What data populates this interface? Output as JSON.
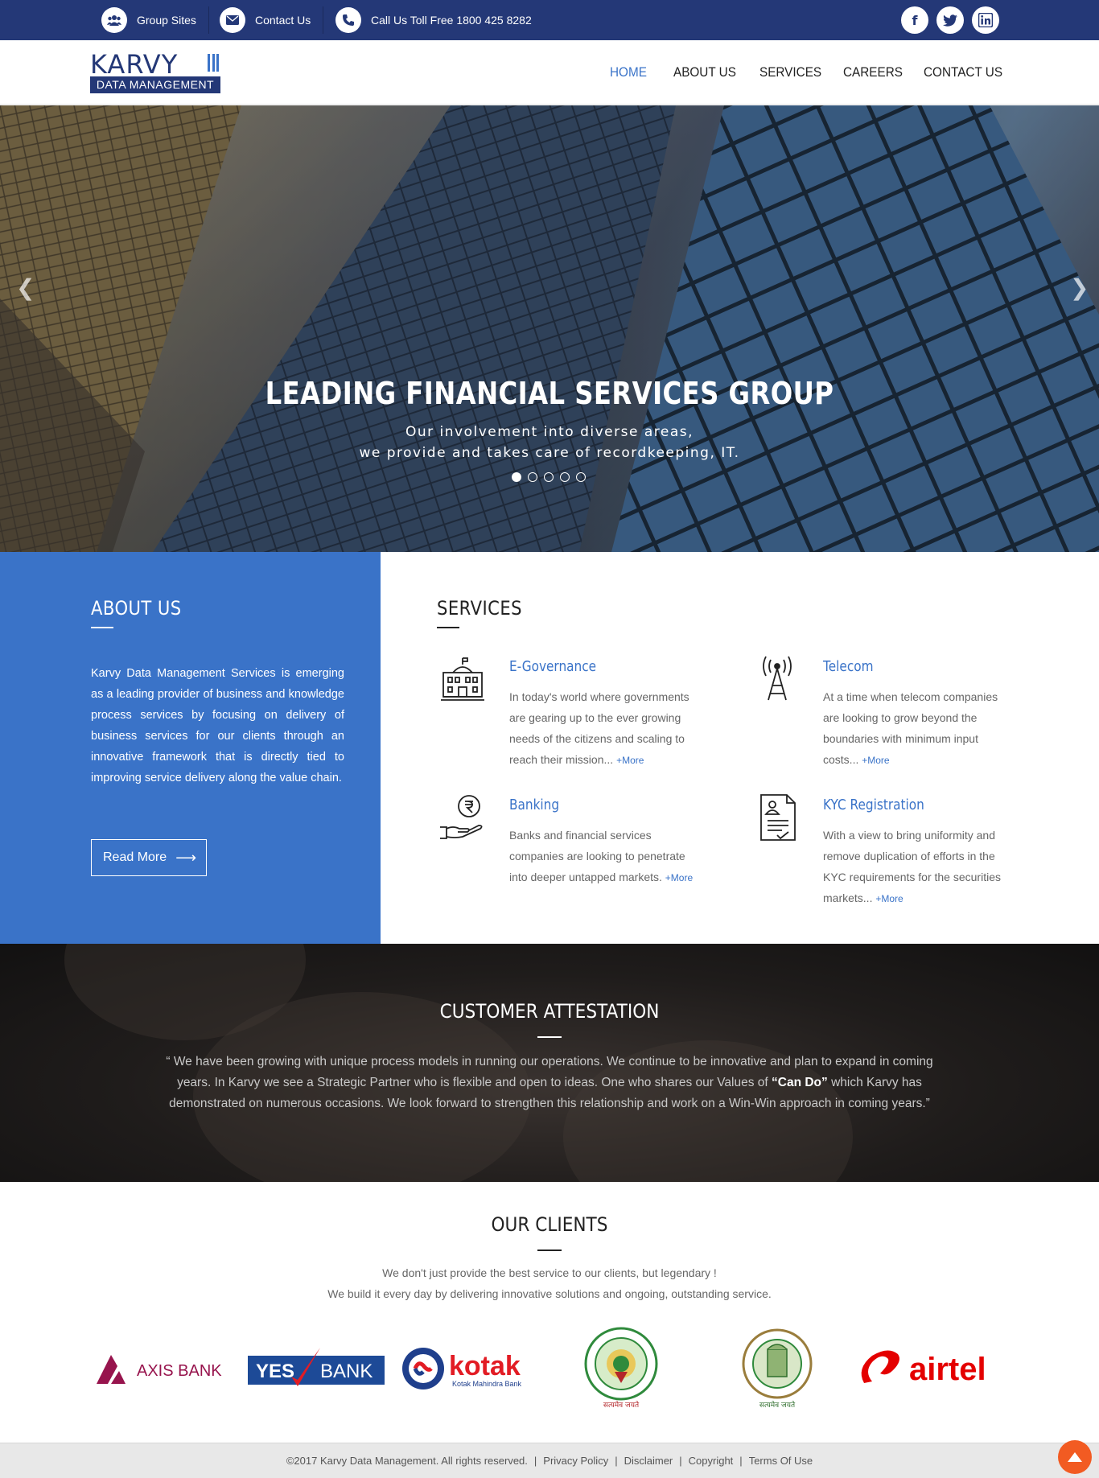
{
  "topbar": {
    "group_sites": "Group Sites",
    "contact_us": "Contact Us",
    "toll_free": "Call Us Toll Free 1800 425 8282",
    "social": [
      "facebook-icon",
      "twitter-icon",
      "linkedin-icon"
    ]
  },
  "logo": {
    "brand": "KARVY",
    "tagline": "DATA MANAGEMENT"
  },
  "nav": {
    "items": [
      "HOME",
      "ABOUT US",
      "SERVICES",
      "CAREERS",
      "CONTACT US"
    ],
    "active": "HOME"
  },
  "hero": {
    "title": "LEADING FINANCIAL SERVICES GROUP",
    "subtitle_line1": "Our involvement into diverse areas,",
    "subtitle_line2": "we provide and takes care of recordkeeping, IT.",
    "slides": 5,
    "active_slide": 1,
    "prev": "❮",
    "next": "❯"
  },
  "about": {
    "title": "ABOUT US",
    "text": "Karvy Data Management Services is emerging as a leading provider of business and knowledge process services by focusing on delivery of business services for our clients through an innovative framework that is directly tied to improving service delivery along the value chain.",
    "button": "Read More"
  },
  "services": {
    "title": "SERVICES",
    "more_label": "+More",
    "items": [
      {
        "title": "E-Governance",
        "desc": "In today's world where governments are gearing up to the ever growing needs of the citizens and scaling to reach their mission...",
        "icon": "government-building-icon"
      },
      {
        "title": "Telecom",
        "desc": "At a time when telecom companies are looking to grow beyond the boundaries with minimum input costs...",
        "icon": "telecom-tower-icon"
      },
      {
        "title": "Banking",
        "desc": "Banks and financial services companies are looking to penetrate into deeper untapped markets.",
        "icon": "rupee-hand-icon"
      },
      {
        "title": "KYC Registration",
        "desc": "With a view to bring uniformity and remove duplication of efforts in the KYC requirements for the securities markets...",
        "icon": "kyc-document-icon"
      }
    ]
  },
  "testimonial": {
    "title": "CUSTOMER ATTESTATION",
    "text_before": "“ We have been growing with unique process models in running our operations. We continue to be innovative and plan to expand in coming years. In Karvy we see a Strategic Partner who is flexible and open to ideas. One who shares our Values of ",
    "text_bold": "“Can Do”",
    "text_after": " which Karvy has demonstrated on numerous occasions. We look forward to strengthen this relationship and work on a Win-Win approach in coming years.”"
  },
  "clients": {
    "title": "OUR CLIENTS",
    "line1": "We don't just provide the best service to our clients, but legendary !",
    "line2": "We build it every day by delivering innovative solutions and ongoing, outstanding service.",
    "logos": {
      "axis": "AXIS BANK",
      "yes_left": "YES",
      "yes_right": "BANK",
      "kotak": "kotak",
      "kotak_sub": "Kotak Mahindra Bank",
      "ap_seal": "GOVERNMENT OF ANDHRA PRADESH",
      "ts_seal": "GOVERNMENT OF TELANGANA",
      "seal_motto": "सत्यमेव जयते",
      "airtel": "airtel"
    }
  },
  "footer": {
    "copyright": "©2017 Karvy Data Management. All rights reserved.",
    "links": [
      "Privacy Policy",
      "Disclaimer",
      "Copyright",
      "Terms Of Use"
    ],
    "sep": "|"
  },
  "colors": {
    "topbar": "#243877",
    "accent": "#3a73c8",
    "back_to_top": "#f25b22"
  }
}
